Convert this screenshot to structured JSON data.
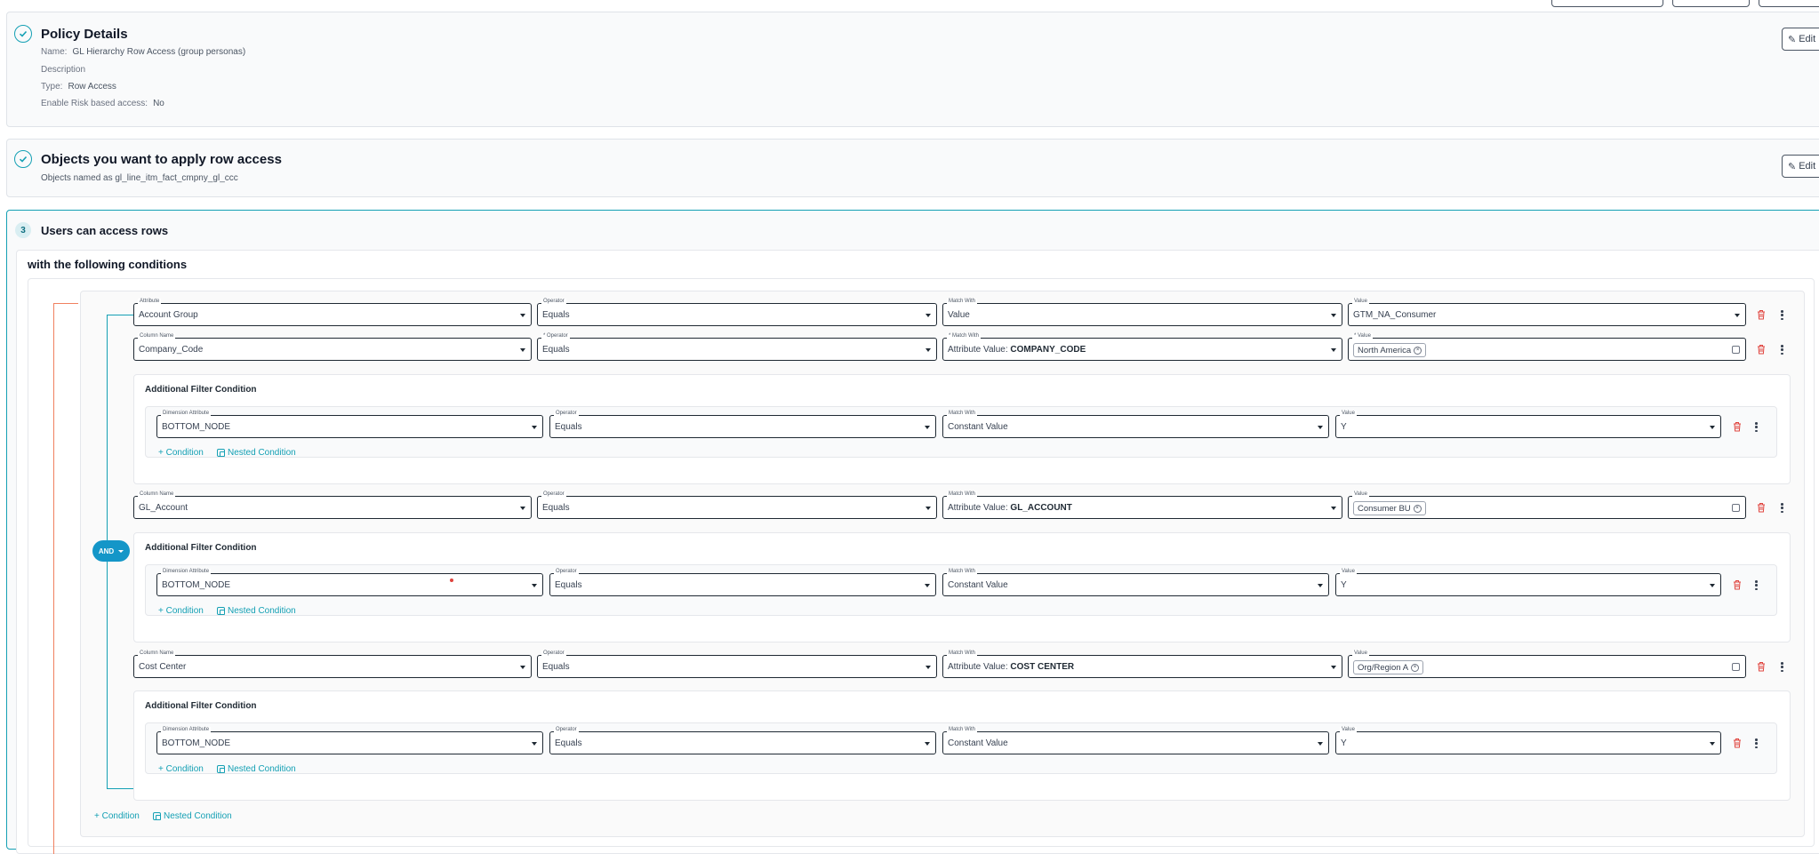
{
  "policy_details": {
    "title": "Policy Details",
    "name_key": "Name:",
    "name_value": "GL Hierarchy Row Access (group personas)",
    "description_key": "Description",
    "type_key": "Type:",
    "type_value": "Row Access",
    "risk_key": "Enable Risk based access:",
    "risk_value": "No",
    "edit_label": "Edit"
  },
  "objects": {
    "title": "Objects you want to apply row access",
    "subtitle": "Objects named as gl_line_itm_fact_cmpny_gl_ccc",
    "edit_label": "Edit"
  },
  "users": {
    "step": "3",
    "title": "Users can access rows",
    "conditions_title": "with the following conditions"
  },
  "logic_operator": "AND",
  "rows": [
    {
      "attribute": {
        "label": "Attribute",
        "value": "Account Group"
      },
      "operator": {
        "label": "Operator",
        "value": "Equals"
      },
      "match": {
        "label": "Match With",
        "value": "Value"
      },
      "value": {
        "label": "Value",
        "value": "GTM_NA_Consumer"
      }
    },
    {
      "attribute": {
        "label": "Column Name",
        "value": "Company_Code"
      },
      "operator": {
        "label": "* Operator",
        "value": "Equals"
      },
      "match": {
        "label": "* Match With",
        "prefix": "Attribute Value:",
        "bold": "COMPANY_CODE"
      },
      "value": {
        "label": "* Value",
        "chip": "North America"
      },
      "afc": {
        "title": "Additional Filter Condition",
        "dimension": {
          "label": "Dimension Attribute",
          "value": "BOTTOM_NODE"
        },
        "operator": {
          "label": "Operator",
          "value": "Equals"
        },
        "match": {
          "label": "Match With",
          "value": "Constant Value"
        },
        "value": {
          "label": "Value",
          "value": "Y"
        },
        "add_condition": "+ Condition",
        "nested_condition": "Nested Condition"
      }
    },
    {
      "attribute": {
        "label": "Column Name",
        "value": "GL_Account"
      },
      "operator": {
        "label": "Operator",
        "value": "Equals"
      },
      "match": {
        "label": "Match With",
        "prefix": "Attribute Value:",
        "bold": "GL_ACCOUNT"
      },
      "value": {
        "label": "Value",
        "chip": "Consumer BU"
      },
      "afc": {
        "title": "Additional Filter Condition",
        "dimension": {
          "label": "Dimension Attribute",
          "value": "BOTTOM_NODE"
        },
        "operator": {
          "label": "Operator",
          "value": "Equals"
        },
        "match": {
          "label": "Match With",
          "value": "Constant Value"
        },
        "value": {
          "label": "Value",
          "value": "Y"
        },
        "add_condition": "+ Condition",
        "nested_condition": "Nested Condition"
      }
    },
    {
      "attribute": {
        "label": "Column Name",
        "value": "Cost Center"
      },
      "operator": {
        "label": "Operator",
        "value": "Equals"
      },
      "match": {
        "label": "Match With",
        "prefix": "Attribute Value:",
        "bold": "COST CENTER"
      },
      "value": {
        "label": "Value",
        "chip": "Org/Region A"
      },
      "afc": {
        "title": "Additional Filter Condition",
        "dimension": {
          "label": "Dimension Attribute",
          "value": "BOTTOM_NODE"
        },
        "operator": {
          "label": "Operator",
          "value": "Equals"
        },
        "match": {
          "label": "Match With",
          "value": "Constant Value"
        },
        "value": {
          "label": "Value",
          "value": "Y"
        },
        "add_condition": "+ Condition",
        "nested_condition": "Nested Condition"
      }
    }
  ],
  "bottom_links": {
    "add_condition": "+ Condition",
    "nested_condition": "Nested Condition"
  },
  "colors": {
    "accent": "#14a0b4",
    "danger": "#e0443e",
    "and_pill": "#1496c8",
    "tree_line": "#f08060"
  }
}
